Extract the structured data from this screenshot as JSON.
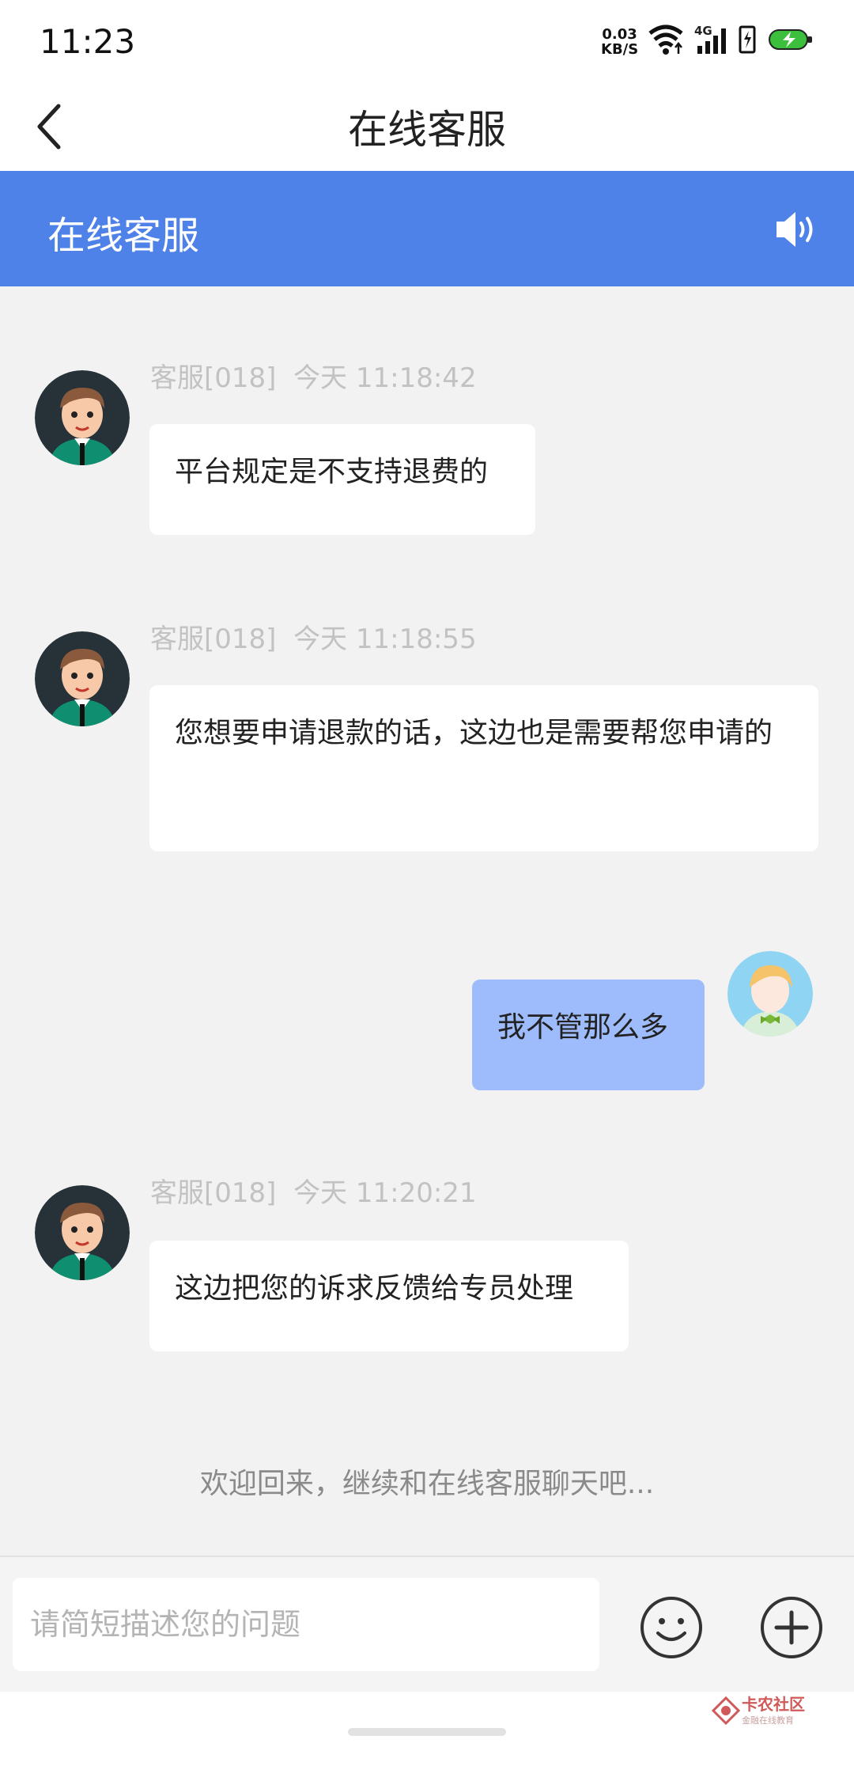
{
  "status_bar": {
    "time": "11:23",
    "net_speed_value": "0.03",
    "net_speed_unit": "KB/S",
    "signal_label": "4G"
  },
  "nav": {
    "title": "在线客服"
  },
  "header": {
    "title": "在线客服"
  },
  "messages": [
    {
      "sender": "客服[018]",
      "time": "今天 11:18:42",
      "text": "平台规定是不支持退费的"
    },
    {
      "sender": "客服[018]",
      "time": "今天 11:18:55",
      "text": "您想要申请退款的话，这边也是需要帮您申请的"
    },
    {
      "text": "我不管那么多"
    },
    {
      "sender": "客服[018]",
      "time": "今天 11:20:21",
      "text": "这边把您的诉求反馈给专员处理"
    }
  ],
  "welcome_text": "欢迎回来，继续和在线客服聊天吧...",
  "input": {
    "placeholder": "请简短描述您的问题"
  },
  "watermark": {
    "title": "卡农社区",
    "subtitle": "金融在线教育"
  },
  "colors": {
    "header_blue": "#4e82e8",
    "user_bubble": "#9ebcfb",
    "chat_background": "#f2f2f2"
  }
}
